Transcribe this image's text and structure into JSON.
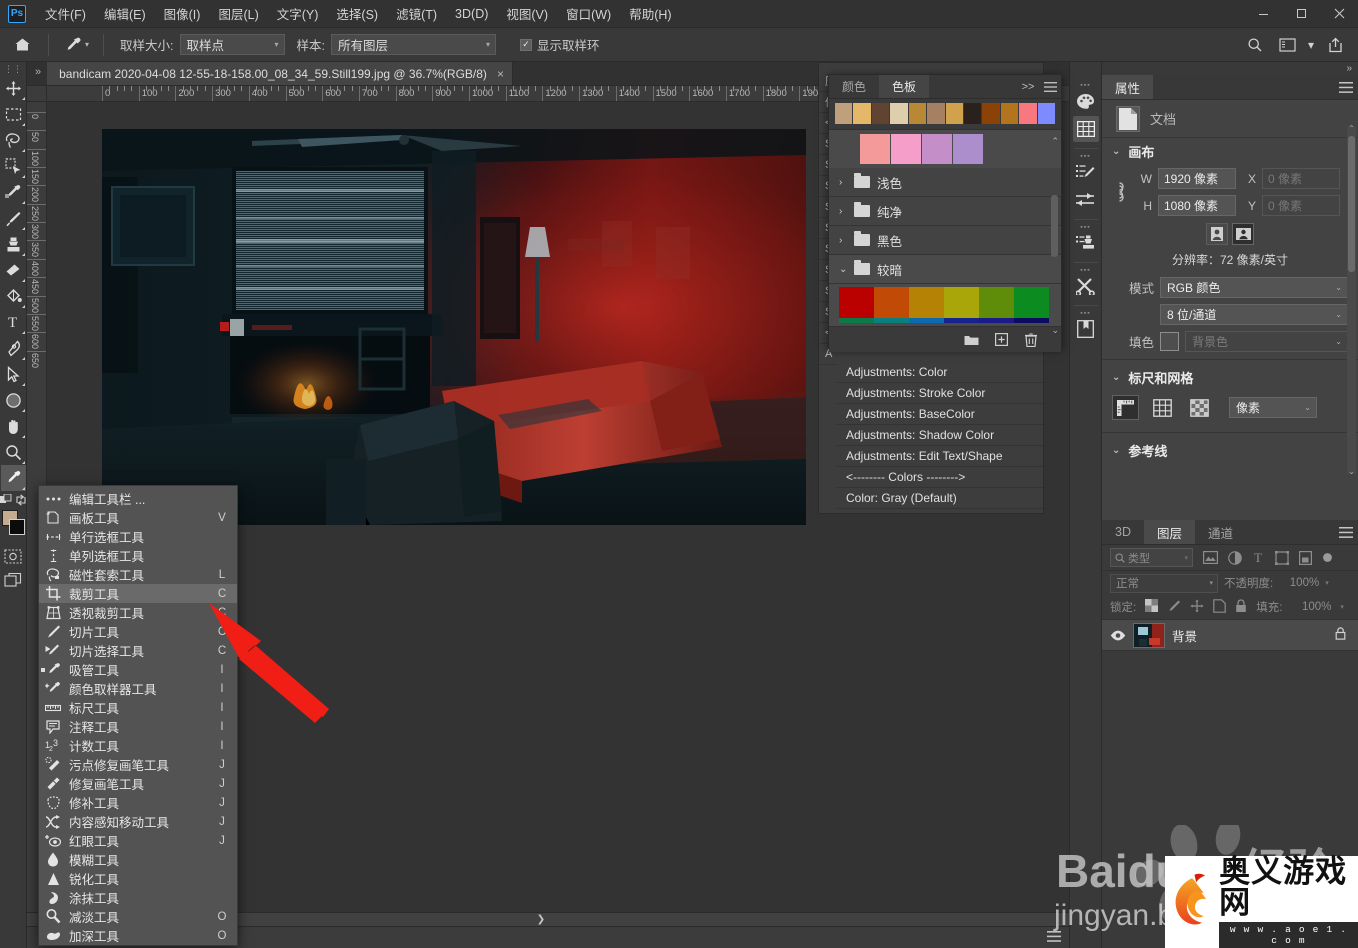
{
  "app": {
    "name": "Ps",
    "logo_color": "#31a8ff"
  },
  "menubar": {
    "items": [
      {
        "label": "文件(F)"
      },
      {
        "label": "编辑(E)"
      },
      {
        "label": "图像(I)"
      },
      {
        "label": "图层(L)"
      },
      {
        "label": "文字(Y)"
      },
      {
        "label": "选择(S)"
      },
      {
        "label": "滤镜(T)"
      },
      {
        "label": "3D(D)"
      },
      {
        "label": "视图(V)"
      },
      {
        "label": "窗口(W)"
      },
      {
        "label": "帮助(H)"
      }
    ],
    "window_controls": [
      "minimize",
      "maximize",
      "close"
    ]
  },
  "optionsbar": {
    "home": "home-icon",
    "tool": "eyedropper-icon",
    "sample_size_label": "取样大小:",
    "sample_size_value": "取样点",
    "sample_label": "样本:",
    "sample_value": "所有图层",
    "show_ring_label": "显示取样环",
    "show_ring_checked": true,
    "right_icons": [
      "search-icon",
      "workspace-icon",
      "chevron-down-icon",
      "share-icon"
    ]
  },
  "toolbar": {
    "tools": [
      {
        "name": "move-tool"
      },
      {
        "name": "marquee-tool"
      },
      {
        "name": "lasso-tool"
      },
      {
        "name": "quick-selection-tool"
      },
      {
        "name": "eyedropper-tool-group"
      },
      {
        "name": "brush-tool"
      },
      {
        "name": "clone-stamp-tool"
      },
      {
        "name": "eraser-tool"
      },
      {
        "name": "paint-bucket-tool"
      },
      {
        "name": "type-tool"
      },
      {
        "name": "pen-tool"
      },
      {
        "name": "path-selection-tool"
      },
      {
        "name": "shape-tool"
      },
      {
        "name": "hand-tool"
      },
      {
        "name": "zoom-tool"
      }
    ],
    "active_tool": "eyedropper-tool",
    "foreground_color": "#c6ac8f",
    "background_color": "#0c0c0c"
  },
  "document": {
    "tab_title": "bandicam 2020-04-08 12-55-18-158.00_08_34_59.Still199.jpg @ 36.7%(RGB/8)",
    "close_label": "×",
    "ruler_labels": [
      "0",
      "100",
      "200",
      "300",
      "400",
      "500",
      "600",
      "700",
      "800",
      "900",
      "1000",
      "1100",
      "1200",
      "1300",
      "1400",
      "1500",
      "1600",
      "1700",
      "1800",
      "190"
    ],
    "ruler_v_labels": [
      "0",
      "50",
      "100",
      "150",
      "200",
      "250",
      "300",
      "350",
      "400",
      "450",
      "500",
      "550",
      "600",
      "650"
    ]
  },
  "tool_flyout": {
    "items": [
      {
        "label": "编辑工具栏 ...",
        "key": "",
        "icon": "ellipsis-icon",
        "selected": false,
        "dot": false
      },
      {
        "label": "画板工具",
        "key": "V",
        "icon": "artboard-icon",
        "selected": false,
        "dot": false
      },
      {
        "label": "单行选框工具",
        "key": "",
        "icon": "single-row-marquee-icon",
        "selected": false,
        "dot": false
      },
      {
        "label": "单列选框工具",
        "key": "",
        "icon": "single-column-marquee-icon",
        "selected": false,
        "dot": false
      },
      {
        "label": "磁性套索工具",
        "key": "L",
        "icon": "magnetic-lasso-icon",
        "selected": false,
        "dot": false
      },
      {
        "label": "裁剪工具",
        "key": "C",
        "icon": "crop-icon",
        "selected": true,
        "dot": false
      },
      {
        "label": "透视裁剪工具",
        "key": "C",
        "icon": "perspective-crop-icon",
        "selected": false,
        "dot": false
      },
      {
        "label": "切片工具",
        "key": "C",
        "icon": "slice-icon",
        "selected": false,
        "dot": false
      },
      {
        "label": "切片选择工具",
        "key": "C",
        "icon": "slice-select-icon",
        "selected": false,
        "dot": false
      },
      {
        "label": "吸管工具",
        "key": "I",
        "icon": "eyedropper-icon",
        "selected": false,
        "dot": true
      },
      {
        "label": "颜色取样器工具",
        "key": "I",
        "icon": "color-sampler-icon",
        "selected": false,
        "dot": false
      },
      {
        "label": "标尺工具",
        "key": "I",
        "icon": "ruler-icon",
        "selected": false,
        "dot": false
      },
      {
        "label": "注释工具",
        "key": "I",
        "icon": "note-icon",
        "selected": false,
        "dot": false
      },
      {
        "label": "计数工具",
        "key": "I",
        "icon": "count-icon",
        "selected": false,
        "dot": false
      },
      {
        "label": "污点修复画笔工具",
        "key": "J",
        "icon": "spot-healing-brush-icon",
        "selected": false,
        "dot": false
      },
      {
        "label": "修复画笔工具",
        "key": "J",
        "icon": "healing-brush-icon",
        "selected": false,
        "dot": false
      },
      {
        "label": "修补工具",
        "key": "J",
        "icon": "patch-icon",
        "selected": false,
        "dot": false
      },
      {
        "label": "内容感知移动工具",
        "key": "J",
        "icon": "content-aware-move-icon",
        "selected": false,
        "dot": false
      },
      {
        "label": "红眼工具",
        "key": "J",
        "icon": "red-eye-icon",
        "selected": false,
        "dot": false
      },
      {
        "label": "模糊工具",
        "key": "",
        "icon": "blur-icon",
        "selected": false,
        "dot": false
      },
      {
        "label": "锐化工具",
        "key": "",
        "icon": "sharpen-icon",
        "selected": false,
        "dot": false
      },
      {
        "label": "涂抹工具",
        "key": "",
        "icon": "smudge-icon",
        "selected": false,
        "dot": false
      },
      {
        "label": "减淡工具",
        "key": "O",
        "icon": "dodge-icon",
        "selected": false,
        "dot": false
      },
      {
        "label": "加深工具",
        "key": "O",
        "icon": "burn-icon",
        "selected": false,
        "dot": false
      }
    ]
  },
  "swatches_panel": {
    "tabs": [
      {
        "label": "颜色",
        "active": false
      },
      {
        "label": "色板",
        "active": true
      }
    ],
    "expand_icon": ">>",
    "menu_icon": "hamburger-icon",
    "recent_colors": [
      "#bfa07a",
      "#e4b868",
      "#614331",
      "#ddcfac",
      "#b98837",
      "#a58063",
      "#d0a24d",
      "#2b211c",
      "#8a4207",
      "#b2741c",
      "#f9787f",
      "#7e8bfd"
    ],
    "light_colors": [
      "#ab8ecb",
      "#c48ec9",
      "#f59ec9",
      "#f59a9a"
    ],
    "groups": [
      {
        "label": "浅色",
        "open": false
      },
      {
        "label": "纯净",
        "open": false
      },
      {
        "label": "黑色",
        "open": false
      },
      {
        "label": "较暗",
        "open": true
      }
    ],
    "dark_group_colors": [
      "#bb0000",
      "#c24a07",
      "#b58205",
      "#a8a609",
      "#5f8d09",
      "#0c8b21"
    ],
    "thin_strip_colors": [
      "#0b7a47",
      "#0b7e7e",
      "#0c69b0",
      "#17228c",
      "#1b1b88",
      "#0b0b60"
    ],
    "footer_icons": [
      "new-group-icon",
      "new-swatch-icon",
      "delete-icon"
    ]
  },
  "behind_list": {
    "rows": [
      "Adjustments: Color",
      "Adjustments: Stroke Color",
      "Adjustments: BaseColor",
      "Adjustments: Shadow Color",
      "Adjustments: Edit Text/Shape",
      "<-------- Colors -------->",
      "Color: Gray (Default)"
    ],
    "left_edge_labels": [
      "历",
      "信",
      "<",
      "S",
      "S",
      "S",
      "S",
      "S",
      "S",
      "S",
      "S",
      "S",
      "<",
      "A"
    ]
  },
  "rail": {
    "icons": [
      {
        "name": "color-palette-icon",
        "active": false
      },
      {
        "name": "swatches-grid-icon",
        "active": true
      },
      {
        "name": "adjustments-brush-icon",
        "active": false
      },
      {
        "name": "adjustments-sliders-icon",
        "active": false
      },
      {
        "name": "styles-stamp-icon",
        "active": false
      },
      {
        "name": "tools-scissors-icon",
        "active": false
      },
      {
        "name": "library-book-icon",
        "active": false
      }
    ]
  },
  "properties_panel": {
    "tab": "属性",
    "menu_icon": "hamburger-icon",
    "doc_row": {
      "icon": "document-icon",
      "label": "文档"
    },
    "canvas": {
      "header": "画布",
      "w_label": "W",
      "w_value": "1920 像素",
      "x_label": "X",
      "x_value": "0 像素",
      "h_label": "H",
      "h_value": "1080 像素",
      "y_label": "Y",
      "y_value": "0 像素",
      "link_icon": "link-icon",
      "orientation": [
        "portrait-icon",
        "landscape-icon"
      ],
      "orientation_selected": "landscape-icon",
      "resolution": "分辨率：72 像素/英寸",
      "mode_label": "模式",
      "mode_value": "RGB 颜色",
      "depth_value": "8 位/通道",
      "fill_label": "填色",
      "fill_value": "背景色"
    },
    "rulers_grid": {
      "header": "标尺和网格",
      "buttons": [
        "ruler-icon",
        "grid-icon",
        "transparency-grid-icon"
      ],
      "selected": "ruler-icon",
      "units": "像素"
    },
    "guides": {
      "header": "参考线"
    }
  },
  "layers_panel": {
    "tabs": [
      {
        "label": "3D",
        "active": false
      },
      {
        "label": "图层",
        "active": true
      },
      {
        "label": "通道",
        "active": false
      }
    ],
    "menu_icon": "hamburger-icon",
    "filter_placeholder": "类型",
    "filter_icons": [
      "image-filter-icon",
      "adjustment-filter-icon",
      "type-filter-icon",
      "shape-filter-icon",
      "smart-object-filter-icon",
      "toggle-filter-icon"
    ],
    "blend_mode": "正常",
    "opacity_label": "不透明度:",
    "opacity_value": "100%",
    "lock_label": "锁定:",
    "lock_icons": [
      "lock-transparency-icon",
      "lock-pixels-icon",
      "lock-position-icon",
      "lock-artboard-icon",
      "lock-all-icon"
    ],
    "fill_label": "填充:",
    "fill_value": "100%",
    "layers": [
      {
        "name": "背景",
        "visible": true,
        "locked": true
      }
    ]
  },
  "statusbar": {
    "menu_icon": "hamburger-icon"
  },
  "watermarks": {
    "baidu_main": "Baidu",
    "baidu_sub": "jingyan.b",
    "aoe_title": "奥义游戏网",
    "aoe_url": "w w w . a o e 1 . c o m"
  },
  "annotation": {
    "arrow": "red-arrow-pointer",
    "color": "#f01e14"
  }
}
